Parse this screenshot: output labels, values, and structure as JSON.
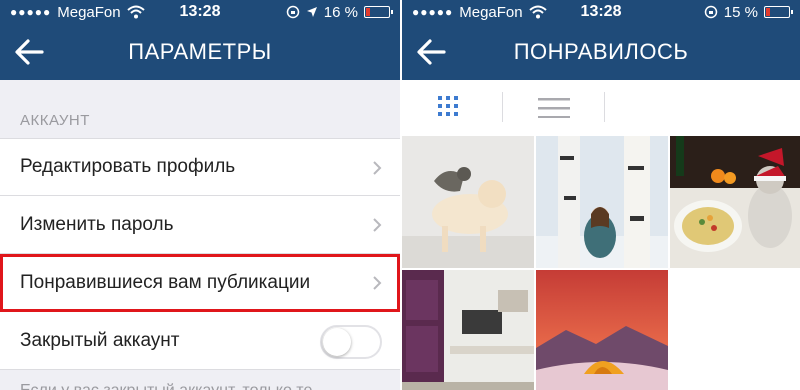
{
  "left_screen": {
    "status": {
      "signal_dots": "●●●●●",
      "carrier": "MegaFon",
      "time": "13:28",
      "battery": "16 %"
    },
    "nav_title": "ПАРАМЕТРЫ",
    "section_header": "АККАУНТ",
    "rows": [
      {
        "label": "Редактировать профиль"
      },
      {
        "label": "Изменить пароль"
      },
      {
        "label": "Понравившиеся вам публикации"
      },
      {
        "label": "Закрытый аккаунт"
      }
    ],
    "footnote": "Если у вас закрытый аккаунт, только те"
  },
  "right_screen": {
    "status": {
      "signal_dots": "●●●●●",
      "carrier": "MegaFon",
      "time": "13:28",
      "battery": "15 %"
    },
    "nav_title": "ПОНРАВИЛОСЬ"
  },
  "colors": {
    "nav_blue": "#1f4b79",
    "highlight_red": "#e0161b",
    "grid_icon_blue": "#3d7bd0"
  },
  "icons": [
    "back-arrow-icon",
    "chevron-right-icon",
    "wifi-icon",
    "location-icon",
    "lock-rotation-icon",
    "battery-icon",
    "grid-view-icon",
    "list-view-icon"
  ]
}
